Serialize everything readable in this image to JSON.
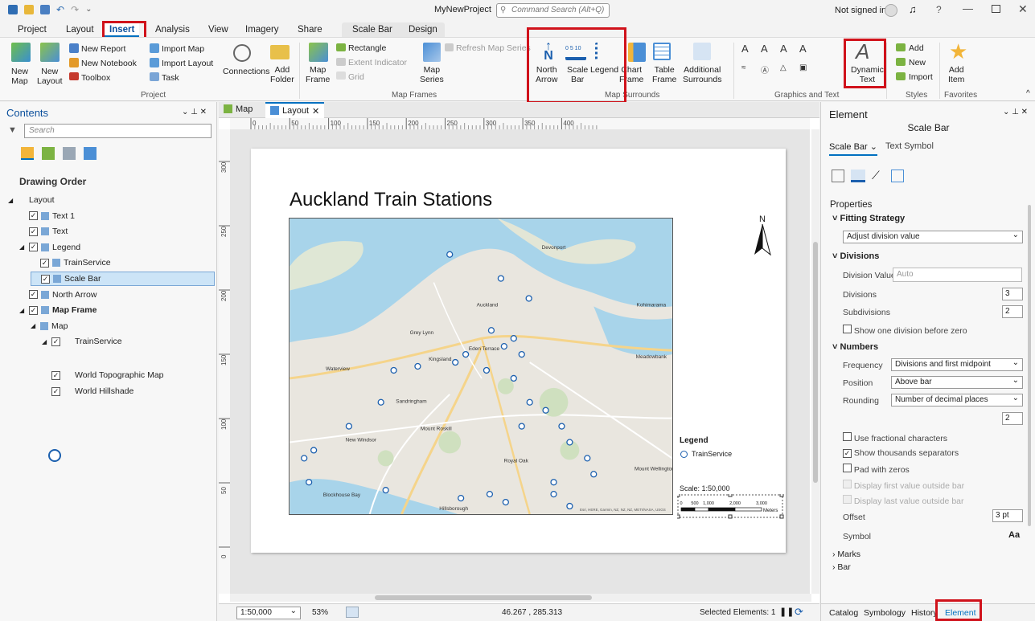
{
  "titlebar": {
    "project_name": "MyNewProject",
    "search_placeholder": "Command Search (Alt+Q)",
    "signin": "Not signed in"
  },
  "ribbon_tabs": [
    "Project",
    "Layout",
    "Insert",
    "Analysis",
    "View",
    "Imagery",
    "Share",
    "Scale Bar",
    "Design"
  ],
  "active_tab": "Insert",
  "ribbon": {
    "project": {
      "new_map": "New\nMap",
      "new_layout": "New\nLayout",
      "new_report": "New Report",
      "new_notebook": "New Notebook",
      "toolbox": "Toolbox",
      "import_map": "Import Map",
      "import_layout": "Import Layout",
      "task": "Task",
      "connections": "Connections",
      "add_folder": "Add\nFolder",
      "group": "Project"
    },
    "map_frames": {
      "map_frame": "Map\nFrame",
      "rectangle": "Rectangle",
      "extent_indicator": "Extent Indicator",
      "grid": "Grid",
      "map_series": "Map\nSeries",
      "refresh_map_series": "Refresh Map Series",
      "group": "Map Frames"
    },
    "surrounds": {
      "north_arrow": "North\nArrow",
      "scale_bar": "Scale\nBar",
      "legend": "Legend",
      "chart_frame": "Chart\nFrame",
      "table_frame": "Table\nFrame",
      "additional": "Additional\nSurrounds",
      "group": "Map Surrounds"
    },
    "graphics": {
      "dynamic_text": "Dynamic\nText",
      "group": "Graphics and Text"
    },
    "styles": {
      "add": "Add",
      "new": "New",
      "import": "Import",
      "group": "Styles"
    },
    "favorites": {
      "add_item": "Add\nItem",
      "group": "Favorites"
    }
  },
  "contents": {
    "title": "Contents",
    "search_placeholder": "Search",
    "drawing_order": "Drawing Order",
    "items": [
      {
        "label": "Layout",
        "level": 0,
        "checkbox": false
      },
      {
        "label": "Text 1",
        "level": 1,
        "checkbox": true
      },
      {
        "label": "Text",
        "level": 1,
        "checkbox": true
      },
      {
        "label": "Legend",
        "level": 1,
        "checkbox": true
      },
      {
        "label": "TrainService",
        "level": 2,
        "checkbox": true
      },
      {
        "label": "Scale Bar",
        "level": 1,
        "checkbox": true,
        "selected": true
      },
      {
        "label": "North Arrow",
        "level": 1,
        "checkbox": true
      },
      {
        "label": "Map Frame",
        "level": 1,
        "checkbox": true,
        "bold": true
      },
      {
        "label": "Map",
        "level": 2,
        "checkbox": false
      },
      {
        "label": "TrainService",
        "level": 3,
        "checkbox": true
      },
      {
        "label": "World Topographic Map",
        "level": 3,
        "checkbox": true
      },
      {
        "label": "World Hillshade",
        "level": 3,
        "checkbox": true
      }
    ]
  },
  "view_tabs": [
    {
      "label": "Map"
    },
    {
      "label": "Layout",
      "active": true
    }
  ],
  "ruler_top": [
    "0",
    "50",
    "100",
    "150",
    "200",
    "250",
    "300",
    "350",
    "400"
  ],
  "ruler_left": [
    "300",
    "250",
    "200",
    "150",
    "100",
    "50",
    "0"
  ],
  "layout": {
    "title": "Auckland Train Stations",
    "legend_title": "Legend",
    "legend_item": "TrainService",
    "scale_text": "Scale: 1:50,000",
    "scale_ticks": [
      "0",
      "500",
      "1,000",
      "2,000",
      "3,000"
    ],
    "scale_units": "Meters",
    "north": "N",
    "map_labels": [
      "Devonport",
      "Auckland",
      "Grey Lynn",
      "Eden Terrace",
      "Kingsland",
      "Waterview",
      "Meadowbank",
      "Sandringham",
      "Mount Roskill",
      "New Windsor",
      "Royal Oak",
      "Mount Wellington",
      "Blockhouse Bay",
      "Hillsborough",
      "Kohimarama"
    ],
    "map_credit": "Esri, HERE, Garmin, NZ, NZ, NZ, METI/NASA, USGS"
  },
  "statusbar": {
    "scale": "1:50,000",
    "zoom": "53%",
    "coords": "46.267 , 285.313",
    "selected": "Selected Elements: 1"
  },
  "element": {
    "title": "Element",
    "subtitle": "Scale Bar",
    "tab_active": "Scale Bar",
    "tab_other": "Text Symbol",
    "properties": "Properties",
    "fitting_strategy": "Fitting Strategy",
    "fitting_value": "Adjust division value",
    "divisions_hdr": "Divisions",
    "division_value_label": "Division Value",
    "division_value_placeholder": "Auto",
    "divisions_label": "Divisions",
    "divisions_value": "3",
    "subdivisions_label": "Subdivisions",
    "subdivisions_value": "2",
    "show_one_division": "Show one division before zero",
    "numbers_hdr": "Numbers",
    "frequency_label": "Frequency",
    "frequency_value": "Divisions and first midpoint",
    "position_label": "Position",
    "position_value": "Above bar",
    "rounding_label": "Rounding",
    "rounding_value": "Number of decimal places",
    "decimals_value": "2",
    "use_fractional": "Use fractional characters",
    "show_thousands": "Show thousands separators",
    "pad_zeros": "Pad with zeros",
    "display_first": "Display first value outside bar",
    "display_last": "Display last value outside bar",
    "offset_label": "Offset",
    "offset_value": "3 pt",
    "symbol_label": "Symbol",
    "symbol_value": "Aa",
    "marks": "Marks",
    "bar": "Bar",
    "bottom_tabs": [
      "Catalog",
      "Symbology",
      "History",
      "Element"
    ]
  },
  "colors": {
    "accent": "#0070c0",
    "highlight": "#d0121b",
    "selected_row": "#cce4f7"
  }
}
